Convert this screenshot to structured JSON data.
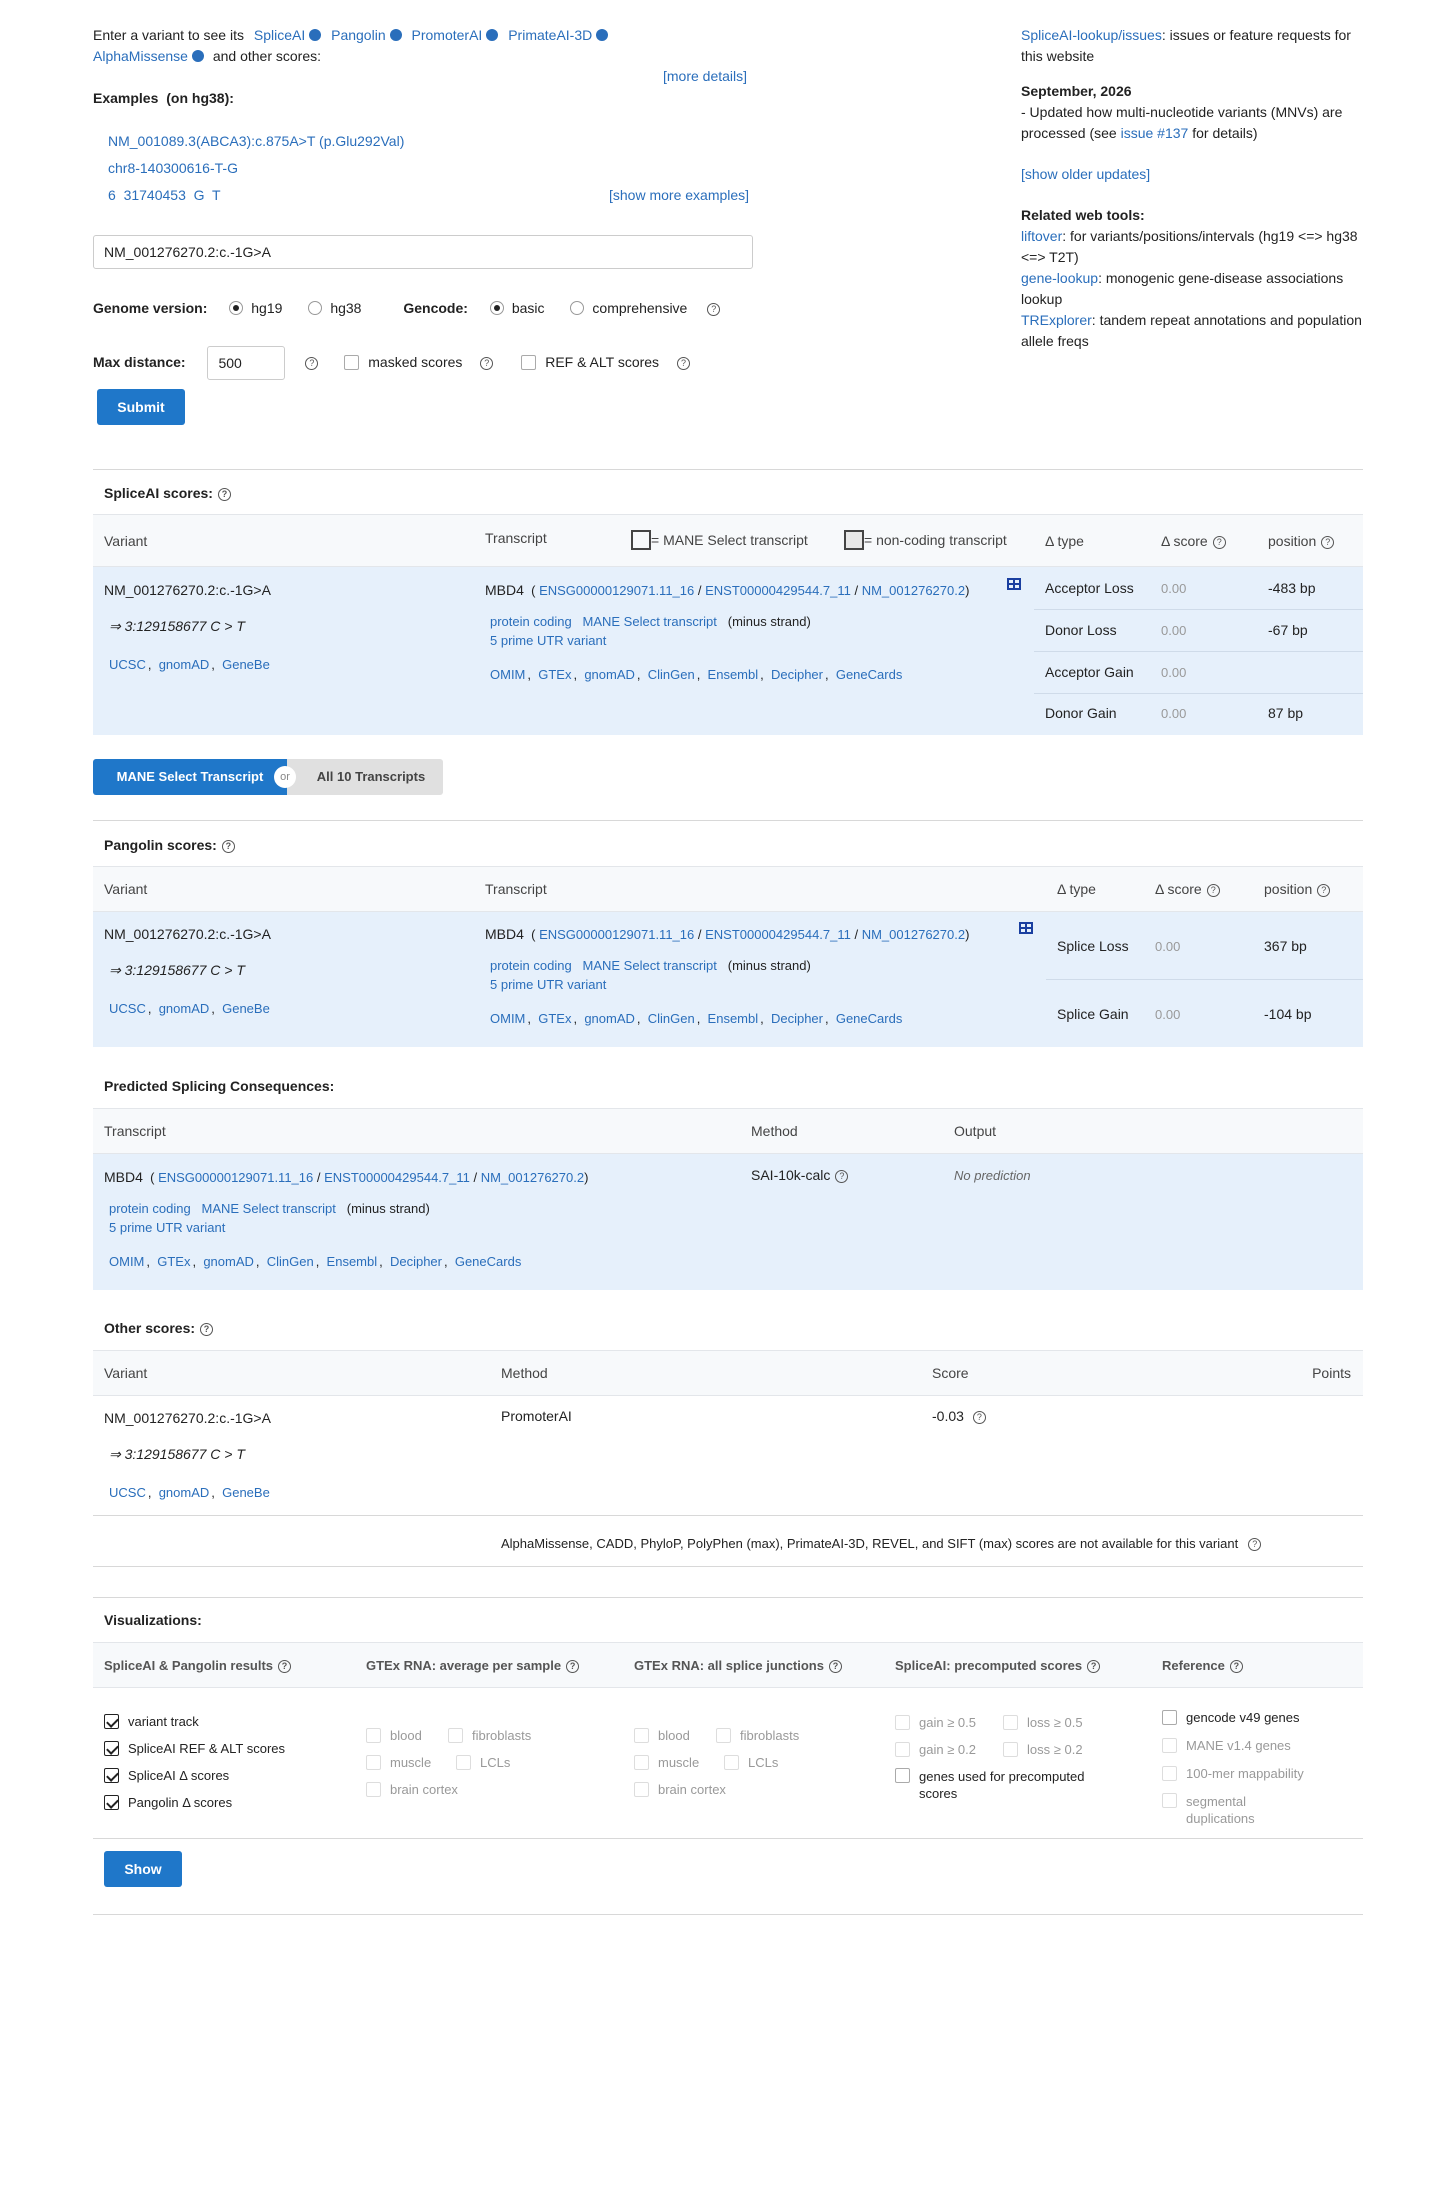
{
  "intro": {
    "text1": "Enter a variant to see its",
    "tools": [
      "SpliceAI",
      "Pangolin",
      "PromoterAI",
      "PrimateAI-3D",
      "AlphaMissense"
    ],
    "text2": "and other scores:",
    "more_details": "[more details]"
  },
  "examples": {
    "title": "Examples",
    "subtitle": "(on hg38):",
    "items": [
      "NM_001089.3(ABCA3):c.875A>T (p.Glu292Val)",
      "chr8-140300616-T-G",
      "6  31740453  G  T"
    ],
    "show_more": "[show more examples]"
  },
  "search": {
    "value": "NM_001276270.2:c.-1G>A"
  },
  "options": {
    "genome_label": "Genome version:",
    "genome_options": [
      "hg19",
      "hg38"
    ],
    "gencode_label": "Gencode:",
    "gencode_options": [
      "basic",
      "comprehensive"
    ],
    "max_distance_label": "Max distance:",
    "max_distance_value": "500",
    "masked_label": "masked scores",
    "refalt_label": "REF & ALT scores",
    "submit": "Submit"
  },
  "sidebar": {
    "issues_link": "SpliceAI-lookup/issues",
    "issues_text": ": issues or feature requests for this website",
    "update_date": "September, 2026",
    "update_text1": "- Updated how multi-nucleotide variants (MNVs) are processed (see",
    "update_link": "issue #137",
    "update_text2": "for details)",
    "older_updates": "[show older updates]",
    "related_title": "Related web tools:",
    "tools": [
      {
        "link": "liftover",
        "text": ": for variants/positions/intervals (hg19 <=> hg38 <=> T2T)"
      },
      {
        "link": "gene-lookup",
        "text": ": monogenic gene-disease associations lookup"
      },
      {
        "link": "TRExplorer",
        "text": ": tandem repeat annotations and population allele freqs"
      }
    ]
  },
  "variant": {
    "name": "NM_001276270.2:c.-1G>A",
    "coords": "⇒ 3:129158677 C > T",
    "links": [
      "UCSC",
      "gnomAD",
      "GeneBe"
    ]
  },
  "transcript": {
    "gene": "MBD4",
    "ids": [
      "ENSG00000129071.11_16",
      "ENST00000429544.7_11",
      "NM_001276270.2"
    ],
    "biotype": "protein coding",
    "mane": "MANE Select transcript",
    "strand": "(minus strand)",
    "consequence": "5 prime UTR variant",
    "links": [
      "OMIM",
      "GTEx",
      "gnomAD",
      "ClinGen",
      "Ensembl",
      "Decipher",
      "GeneCards"
    ]
  },
  "spliceai": {
    "title": "SpliceAI scores:",
    "col_variant": "Variant",
    "col_transcript": "Transcript",
    "legend_mane": "= MANE Select transcript",
    "legend_noncoding": "= non-coding transcript",
    "col_type": "Δ type",
    "col_score": "Δ score",
    "col_position": "position",
    "rows": [
      {
        "type": "Acceptor Loss",
        "score": "0.00",
        "position": "-483 bp"
      },
      {
        "type": "Donor Loss",
        "score": "0.00",
        "position": "-67 bp"
      },
      {
        "type": "Acceptor Gain",
        "score": "0.00",
        "position": ""
      },
      {
        "type": "Donor Gain",
        "score": "0.00",
        "position": "87 bp"
      }
    ]
  },
  "toggle": {
    "left": "MANE Select Transcript",
    "or": "or",
    "right": "All 10 Transcripts"
  },
  "pangolin": {
    "title": "Pangolin scores:",
    "col_variant": "Variant",
    "col_transcript": "Transcript",
    "col_type": "Δ type",
    "col_score": "Δ score",
    "col_position": "position",
    "rows": [
      {
        "type": "Splice Loss",
        "score": "0.00",
        "position": "367 bp"
      },
      {
        "type": "Splice Gain",
        "score": "0.00",
        "position": "-104 bp"
      }
    ]
  },
  "consequences": {
    "title": "Predicted Splicing Consequences:",
    "col_transcript": "Transcript",
    "col_method": "Method",
    "col_output": "Output",
    "method": "SAI-10k-calc",
    "output": "No prediction"
  },
  "other": {
    "title": "Other scores:",
    "col_variant": "Variant",
    "col_method": "Method",
    "col_score": "Score",
    "col_points": "Points",
    "method": "PromoterAI",
    "score": "-0.03",
    "not_available": "AlphaMissense,  CADD,  PhyloP,  PolyPhen (max),  PrimateAI-3D,  REVEL,  and SIFT (max) scores are not available for this variant"
  },
  "viz": {
    "title": "Visualizations:",
    "col1": "SpliceAI & Pangolin results",
    "col2": "GTEx RNA: average per sample",
    "col3": "GTEx RNA: all splice junctions",
    "col4": "SpliceAI: precomputed scores",
    "col5": "Reference",
    "results": [
      "variant track",
      "SpliceAI REF & ALT scores",
      "SpliceAI Δ scores",
      "Pangolin Δ scores"
    ],
    "tissues": [
      "blood",
      "fibroblasts",
      "muscle",
      "LCLs",
      "brain cortex"
    ],
    "precomputed": [
      "gain ≥ 0.5",
      "loss ≥ 0.5",
      "gain ≥ 0.2",
      "loss ≥ 0.2",
      "genes used for precomputed scores"
    ],
    "reference": [
      "gencode v49 genes",
      "MANE v1.4 genes",
      "100-mer mappability",
      "segmental duplications"
    ],
    "show": "Show"
  }
}
